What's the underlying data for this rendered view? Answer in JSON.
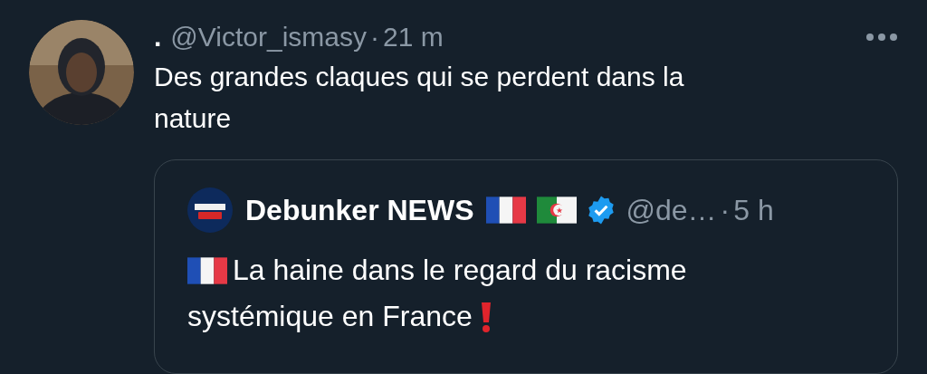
{
  "tweet": {
    "author_name": ".",
    "handle": "@Victor_ismasy",
    "separator": "·",
    "time": "21 m",
    "text": "Des grandes claques qui se perdent dans la nature",
    "quote": {
      "author_name": "Debunker NEWS",
      "verified": true,
      "handle": "@de…",
      "separator": "·",
      "time": "5 h",
      "text_lines": [
        "La haine dans le regard du racisme",
        "systémique en France"
      ]
    }
  }
}
